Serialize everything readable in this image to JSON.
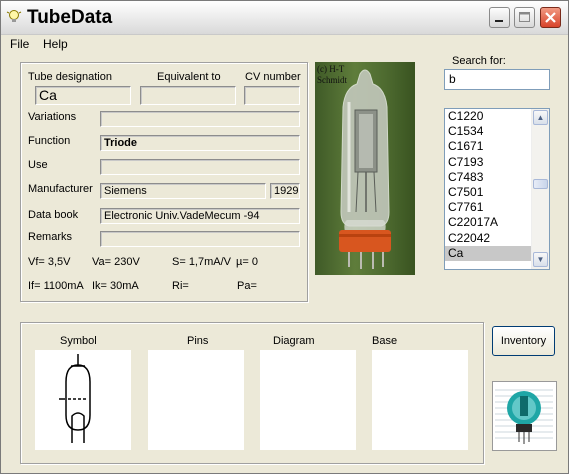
{
  "window": {
    "title": "TubeData",
    "icon": "lightbulb-icon"
  },
  "menu": {
    "file": "File",
    "help": "Help"
  },
  "fields": {
    "designation_label": "Tube designation",
    "designation_value": "Ca",
    "equivalent_label": "Equivalent to",
    "equivalent_value": "",
    "cv_label": "CV number",
    "cv_value": "",
    "variations_label": "Variations",
    "variations_value": "",
    "function_label": "Function",
    "function_value": "Triode",
    "use_label": "Use",
    "use_value": "",
    "manufacturer_label": "Manufacturer",
    "manufacturer_value": "Siemens",
    "year_value": "1929",
    "databook_label": "Data book",
    "databook_value": "Electronic Univ.VadeMecum -94",
    "remarks_label": "Remarks",
    "remarks_value": ""
  },
  "specs": {
    "vf": "Vf= 3,5V",
    "va": "Va= 230V",
    "s": "S= 1,7mA/V",
    "mu": "µ=   0",
    "if": "If= 1100mA",
    "ik": "Ik=   30mA",
    "ri": "Ri=",
    "pa": "Pa="
  },
  "photo": {
    "caption_line1": "(c) H-T",
    "caption_line2": "Schmidt"
  },
  "search": {
    "label": "Search for:",
    "value": "b"
  },
  "list": {
    "items": [
      "C1220",
      "C1534",
      "C1671",
      "C7193",
      "C7483",
      "C7501",
      "C7761",
      "C22017A",
      "C22042",
      "Ca"
    ],
    "selected": "Ca"
  },
  "panels": {
    "symbol": "Symbol",
    "pins": "Pins",
    "diagram": "Diagram",
    "base": "Base"
  },
  "buttons": {
    "inventory": "Inventory"
  },
  "colors": {
    "window_bg": "#ece9d8",
    "close_button": "#d8432a",
    "list_selection": "#c8c8c8",
    "logo_accent": "#1fa6a6"
  }
}
